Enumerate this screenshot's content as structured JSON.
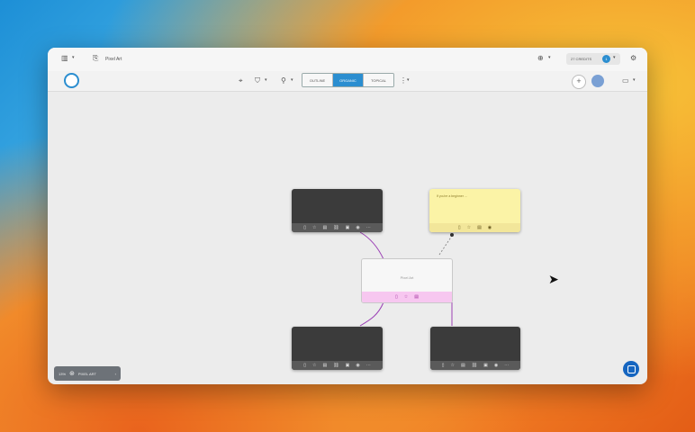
{
  "window": {
    "tab_title": "Pixel Art",
    "credits_label": "27 CREDITS",
    "credits_badge": "1"
  },
  "toolbar": {
    "views": [
      "OUTLINE",
      "ORGANIC",
      "TOPICAL"
    ],
    "active_view": "ORGANIC"
  },
  "nodes": {
    "top_left": "",
    "top_right": "If you're a beginner ...",
    "center": "Pixel Art",
    "bottom_left": "",
    "bottom_right": ""
  },
  "zoom": {
    "level": "13%",
    "label": "PIXEL ART"
  },
  "colors": {
    "accent": "#2b8ed0",
    "connector_purple": "#9b3fb5",
    "node_dark": "#3b3b3b",
    "node_yellow": "#fbf3a6",
    "node_center_footer": "#f7c7f0"
  }
}
